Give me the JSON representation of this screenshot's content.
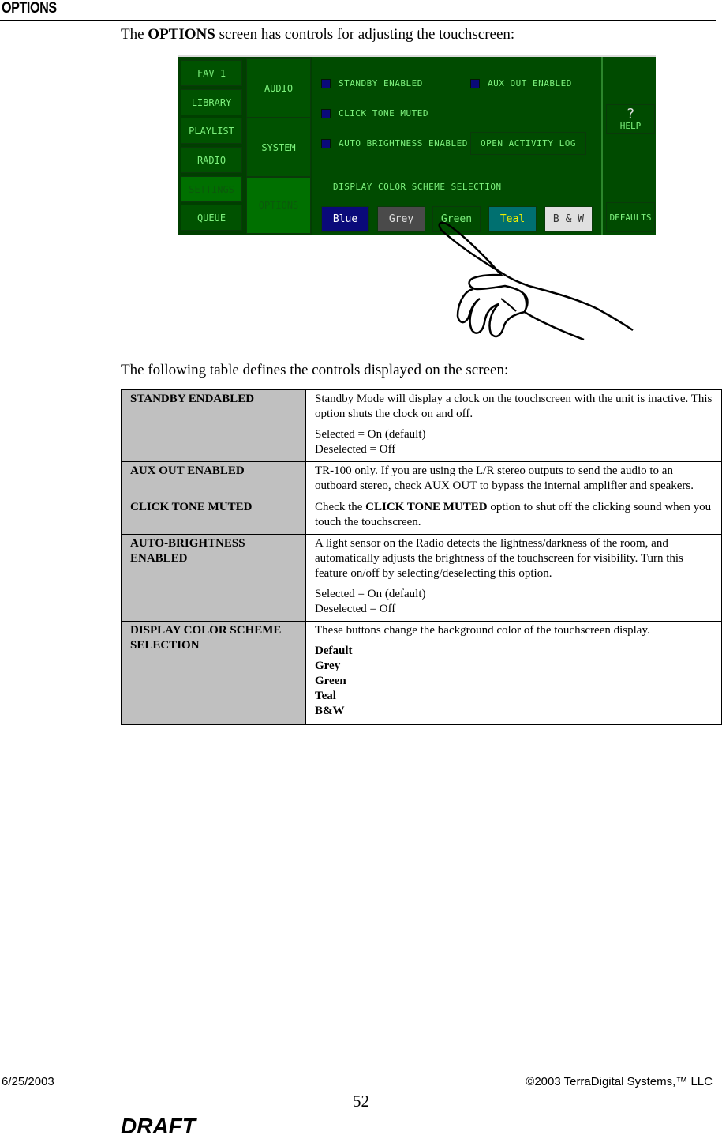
{
  "heading": "OPTIONS",
  "intro": {
    "prefix": "The ",
    "bold": "OPTIONS",
    "suffix": " screen has controls for adjusting the touchscreen:"
  },
  "screen": {
    "nav_primary": [
      {
        "label": "FAV 1",
        "active": false
      },
      {
        "label": "LIBRARY",
        "active": false
      },
      {
        "label": "PLAYLIST",
        "active": false
      },
      {
        "label": "RADIO",
        "active": false
      },
      {
        "label": "SETTINGS",
        "active": true
      },
      {
        "label": "QUEUE",
        "active": false
      }
    ],
    "nav_secondary": [
      {
        "label": "AUDIO",
        "active": false
      },
      {
        "label": "SYSTEM",
        "active": false
      },
      {
        "label": "OPTIONS",
        "active": true
      }
    ],
    "options": [
      {
        "label": "STANDBY ENABLED",
        "checked": false
      },
      {
        "label": "AUX OUT ENABLED",
        "checked": false
      },
      {
        "label": "CLICK TONE MUTED",
        "checked": false
      },
      {
        "label": "AUTO BRIGHTNESS ENABLED",
        "checked": false
      }
    ],
    "open_log_label": "OPEN ACTIVITY LOG",
    "scheme_label": "DISPLAY COLOR SCHEME SELECTION",
    "schemes": [
      {
        "label": "Blue",
        "bg": "#0a0a7a",
        "fg": "#ffffff"
      },
      {
        "label": "Grey",
        "bg": "#4a4a4a",
        "fg": "#e0e0e0"
      },
      {
        "label": "Green",
        "bg": "#004b00",
        "fg": "#7cf07c"
      },
      {
        "label": "Teal",
        "bg": "#007070",
        "fg": "#f0f000"
      },
      {
        "label": "B & W",
        "bg": "#e0e0e0",
        "fg": "#333333"
      }
    ],
    "help_symbol": "?",
    "help_label": "HELP",
    "defaults_label": "DEFAULTS"
  },
  "table_intro": "The following table defines the controls displayed on the screen:",
  "table": [
    {
      "term": "STANDBY ENDABLED",
      "desc": [
        "Standby Mode will display a clock on the touchscreen with the unit is inactive.  This option shuts the clock on and off."
      ],
      "extra": [
        "Selected = On (default)",
        "Deselected = Off"
      ]
    },
    {
      "term": "AUX OUT ENABLED",
      "desc": [
        "TR-100 only.  If you are using the L/R stereo outputs to send the audio to an outboard stereo, check AUX OUT to bypass the internal amplifier and speakers."
      ],
      "extra": []
    },
    {
      "term": "CLICK TONE MUTED",
      "desc_prefix": "Check the ",
      "desc_bold": "CLICK TONE MUTED",
      "desc_suffix": " option to shut off the clicking sound when you touch the touchscreen."
    },
    {
      "term": "AUTO-BRIGHTNESS ENABLED",
      "desc": [
        "A light sensor on the Radio detects the lightness/darkness of the room, and automatically adjusts the brightness of the touchscreen for visibility.  Turn this feature on/off by selecting/deselecting this option."
      ],
      "extra": [
        "Selected = On (default)",
        "Deselected = Off"
      ]
    },
    {
      "term": "DISPLAY COLOR SCHEME SELECTION",
      "desc": [
        "These buttons change the background color of the touchscreen display."
      ],
      "list": [
        "Default",
        "Grey",
        "Green",
        "Teal",
        "B&W"
      ]
    }
  ],
  "footer": {
    "date": "6/25/2003",
    "copyright": "©2003 TerraDigital Systems,™ LLC",
    "page": "52",
    "draft": "DRAFT"
  }
}
